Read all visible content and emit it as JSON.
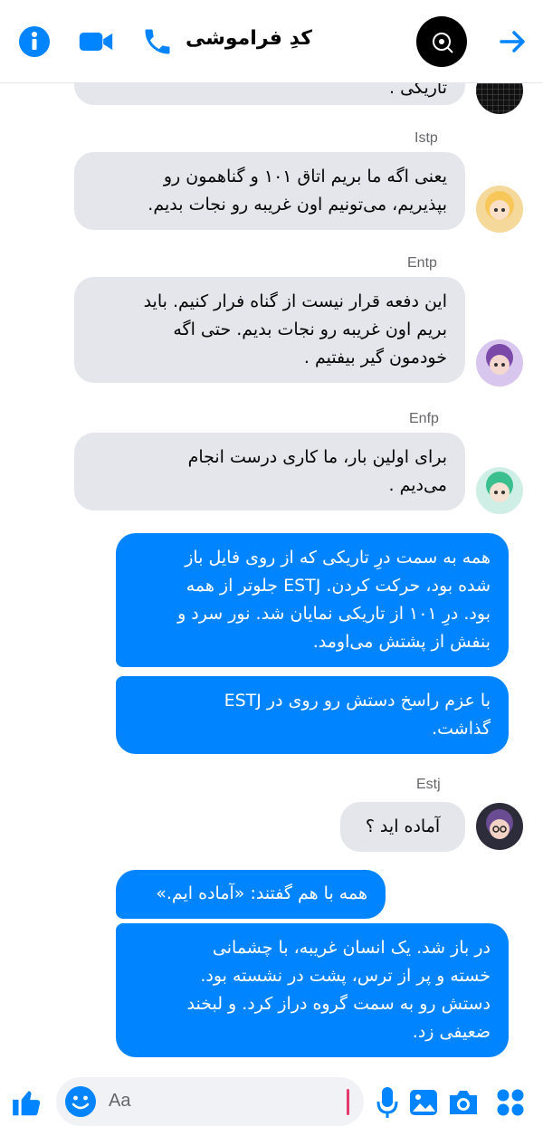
{
  "header": {
    "title": "کدِ فراموشی",
    "icons": [
      "info-icon",
      "video-call-icon",
      "phone-icon",
      "back-arrow-icon"
    ],
    "accent": "#0084ff"
  },
  "messages": {
    "top_fragment": "تاریکی .",
    "m1": {
      "sender": "Istp",
      "lines": [
        "یعنی اگه ما بریم اتاق ۱۰۱ و گناهمون رو",
        "بپذیریم، می‌تونیم اون غریبه رو نجات بدیم."
      ]
    },
    "m2": {
      "sender": "Entp",
      "lines": [
        "این دفعه قرار نیست از گناه فرار کنیم. باید",
        "بریم اون غریبه رو نجات بدیم. حتی اگه",
        "خودمون گیر بیفتیم ."
      ]
    },
    "m3": {
      "sender": "Enfp",
      "lines": [
        "برای اولین بار، ما کاری درست انجام",
        "می‌دیم ."
      ]
    },
    "m4": {
      "lines": [
        "همه به سمت درِ تاریکی که از روی فایل باز",
        "شده بود، حرکت کردن. ESTJ جلوتر از همه",
        "بود. درِ ۱۰۱ از تاریکی نمایان شد. نور سرد و",
        "بنفش از پشتش می‌اومد."
      ]
    },
    "m5": {
      "lines": [
        "با عزم راسخ دستش رو روی در ESTJ",
        "گذاشت."
      ]
    },
    "m6": {
      "sender": "Estj",
      "lines": [
        "آماده اید ؟"
      ]
    },
    "m7": {
      "lines": [
        "همه با هم گفتند: «آماده ایم.»"
      ]
    },
    "m8": {
      "lines": [
        "در باز شد. یک انسان غریبه، با چشمانی",
        "خسته و پر از ترس، پشت در نشسته بود.",
        "دستش رو به سمت گروه دراز کرد. و لبخند",
        "ضعیفی زد."
      ]
    }
  },
  "composer": {
    "placeholder": "Aa",
    "icons": [
      "like-icon",
      "emoji-icon",
      "mic-icon",
      "gallery-icon",
      "camera-icon",
      "apps-icon"
    ]
  }
}
